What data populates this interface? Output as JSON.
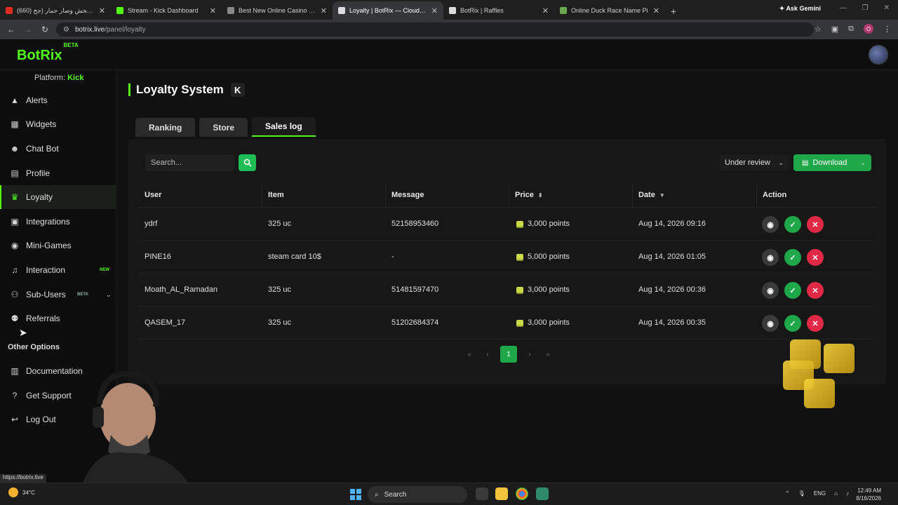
{
  "browser": {
    "tabs": [
      {
        "title": "(660) كبر الجحش وصار حمار (جح...",
        "favcolor": "#e02b20"
      },
      {
        "title": "Stream - Kick Dashboard",
        "favcolor": "#53fc18"
      },
      {
        "title": "Best New Online Casino Ga",
        "favcolor": "#888888"
      },
      {
        "title": "Loyalty | BotRix — Cloud Stream",
        "favcolor": "#dddddd"
      },
      {
        "title": "BotRix | Raffles",
        "favcolor": "#dddddd"
      },
      {
        "title": "Online Duck Race Name Pi",
        "favcolor": "#6aa84f"
      }
    ],
    "gemini": "Ask Gemini",
    "url_host": "botrix.live",
    "url_path": "/panel/loyalty",
    "profile_initial": "O",
    "status_url": "https://botrix.live"
  },
  "app": {
    "logo": "BotRix",
    "logo_badge": "BETA",
    "platform_label": "Platform:",
    "platform_value": "Kick"
  },
  "sidebar": {
    "items": [
      {
        "label": "Alerts",
        "icon": "warning-icon"
      },
      {
        "label": "Widgets",
        "icon": "widgets-icon"
      },
      {
        "label": "Chat Bot",
        "icon": "robot-icon"
      },
      {
        "label": "Profile",
        "icon": "profile-card-icon"
      },
      {
        "label": "Loyalty",
        "icon": "trophy-icon"
      },
      {
        "label": "Integrations",
        "icon": "integrations-icon"
      },
      {
        "label": "Mini-Games",
        "icon": "gamepad-icon"
      },
      {
        "label": "Interaction",
        "icon": "music-icon",
        "badge": "NEW"
      },
      {
        "label": "Sub-Users",
        "icon": "users-icon",
        "badge": "BETA"
      },
      {
        "label": "Referrals",
        "icon": "referrals-icon"
      }
    ],
    "other_title": "Other Options",
    "other_items": [
      {
        "label": "Documentation",
        "icon": "docs-icon"
      },
      {
        "label": "Get Support",
        "icon": "help-icon"
      },
      {
        "label": "Log Out",
        "icon": "logout-icon"
      }
    ]
  },
  "page": {
    "title": "Loyalty System",
    "platform_badge": "K",
    "tabs": [
      "Ranking",
      "Store",
      "Sales log"
    ],
    "active_tab": "Sales log",
    "search_placeholder": "Search...",
    "filter_value": "Under review",
    "download_label": "Download"
  },
  "table": {
    "headers": {
      "user": "User",
      "item": "Item",
      "message": "Message",
      "price": "Price",
      "date": "Date",
      "action": "Action"
    },
    "rows": [
      {
        "user": "ydrf",
        "item": "325 uc",
        "message": "52158953460",
        "price": "3,000 points",
        "date": "Aug 14, 2026 09:16"
      },
      {
        "user": "PINE16",
        "item": "steam card 10$",
        "message": "-",
        "price": "5,000 points",
        "date": "Aug 14, 2026 01:05"
      },
      {
        "user": "Moath_AL_Ramadan",
        "item": "325 uc",
        "message": "51481597470",
        "price": "3,000 points",
        "date": "Aug 14, 2026 00:36"
      },
      {
        "user": "QASEM_17",
        "item": "325 uc",
        "message": "51202684374",
        "price": "3,000 points",
        "date": "Aug 14, 2026 00:35"
      }
    ]
  },
  "pagination": {
    "current": "1"
  },
  "taskbar": {
    "weather_temp": "34°C",
    "search_label": "Search",
    "lang": "ENG",
    "time": "12:49 AM",
    "date": "8/16/2026"
  },
  "colors": {
    "accent": "#53fc18",
    "approve": "#1fa84a",
    "reject": "#e02847"
  }
}
